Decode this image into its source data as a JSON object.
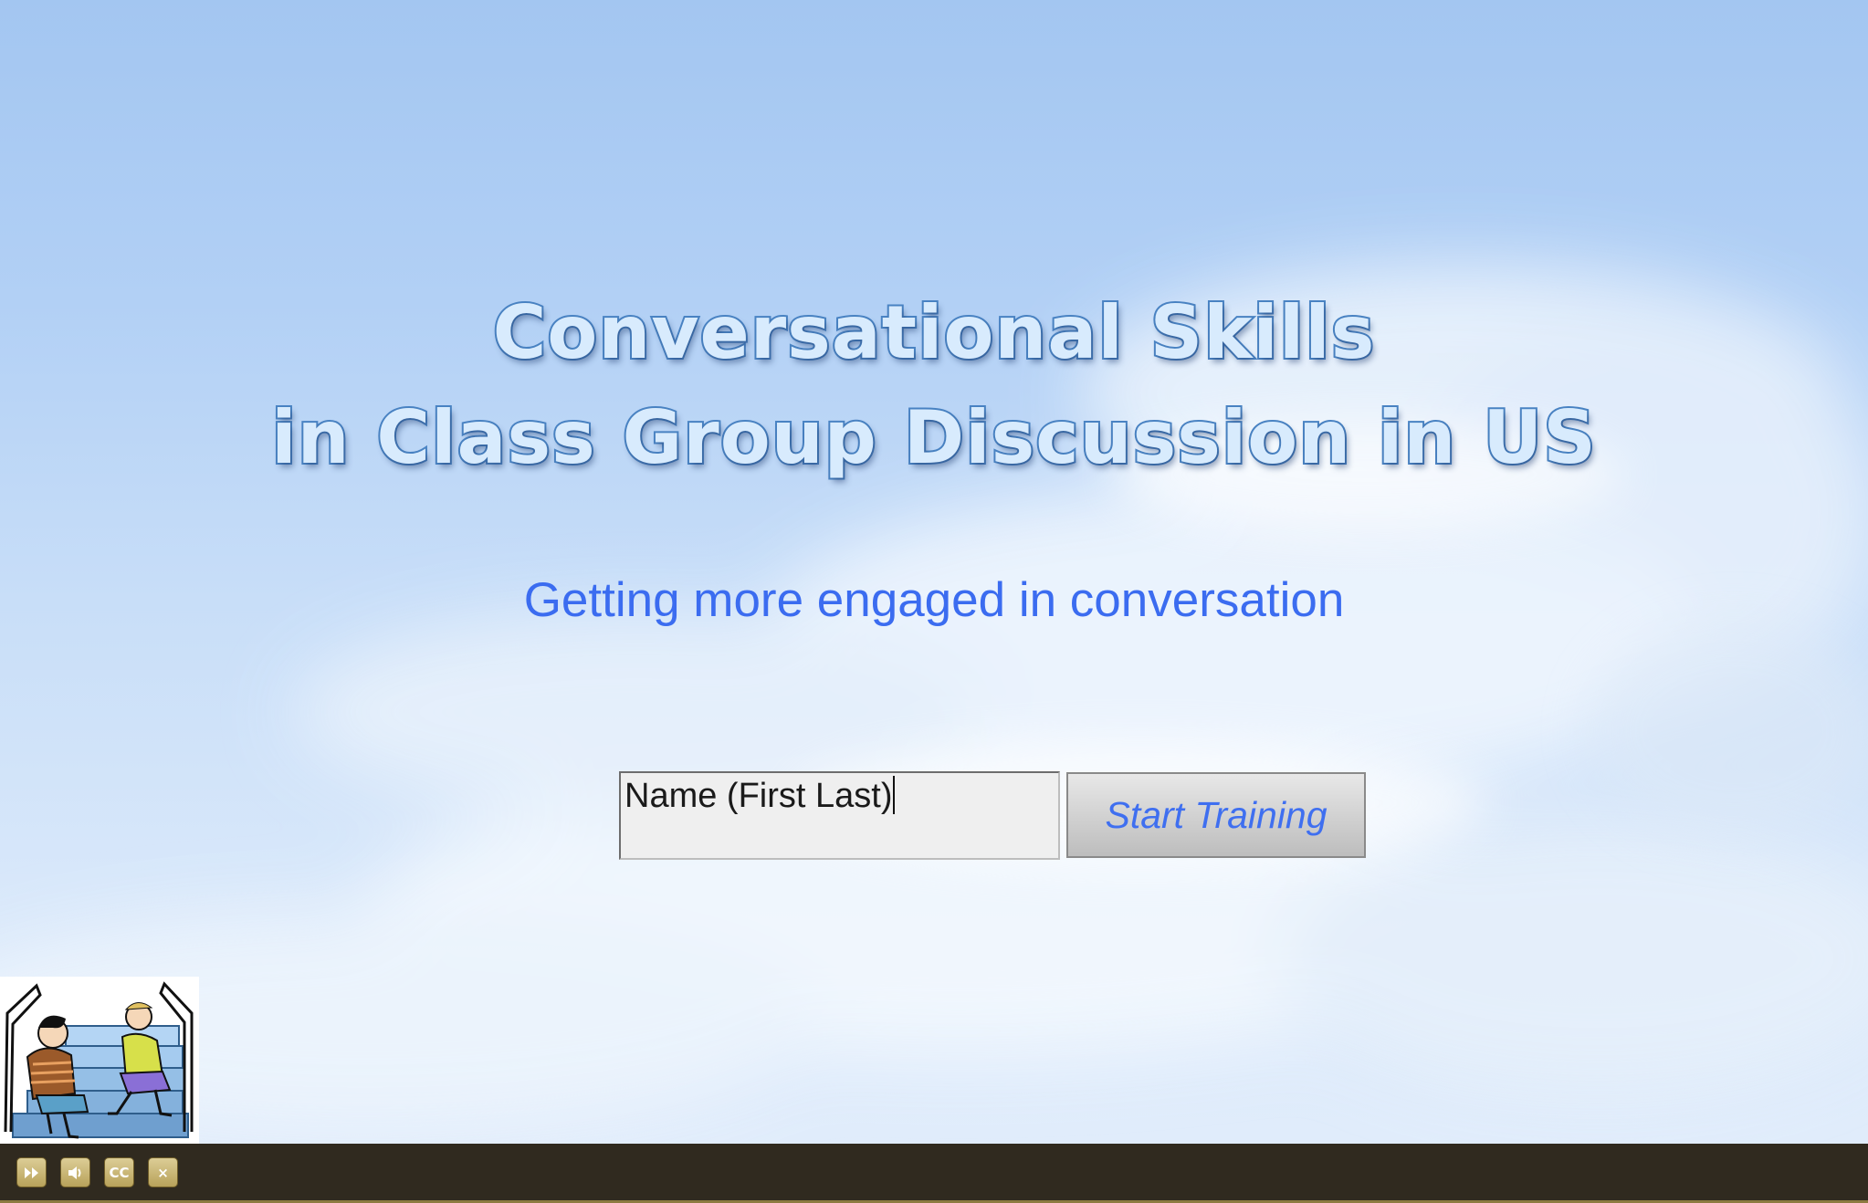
{
  "title": {
    "line1": "Conversational Skills",
    "line2": "in Class Group Discussion in US"
  },
  "subtitle": "Getting more engaged in conversation",
  "form": {
    "name_value": "Name (First Last)",
    "start_button_label": "Start Training"
  },
  "controls": [
    {
      "icon": "fast-forward-icon"
    },
    {
      "icon": "speaker-icon"
    },
    {
      "icon": "closed-captions-icon",
      "label": "CC"
    },
    {
      "icon": "close-icon",
      "label": "×"
    }
  ],
  "colors": {
    "title_fill": "#d8ebfd",
    "title_outline": "#4a84c4",
    "subtitle": "#3b6cf0",
    "button_text": "#3f6ff0",
    "control_bar": "#302a1f",
    "control_button": "#c9b777"
  }
}
